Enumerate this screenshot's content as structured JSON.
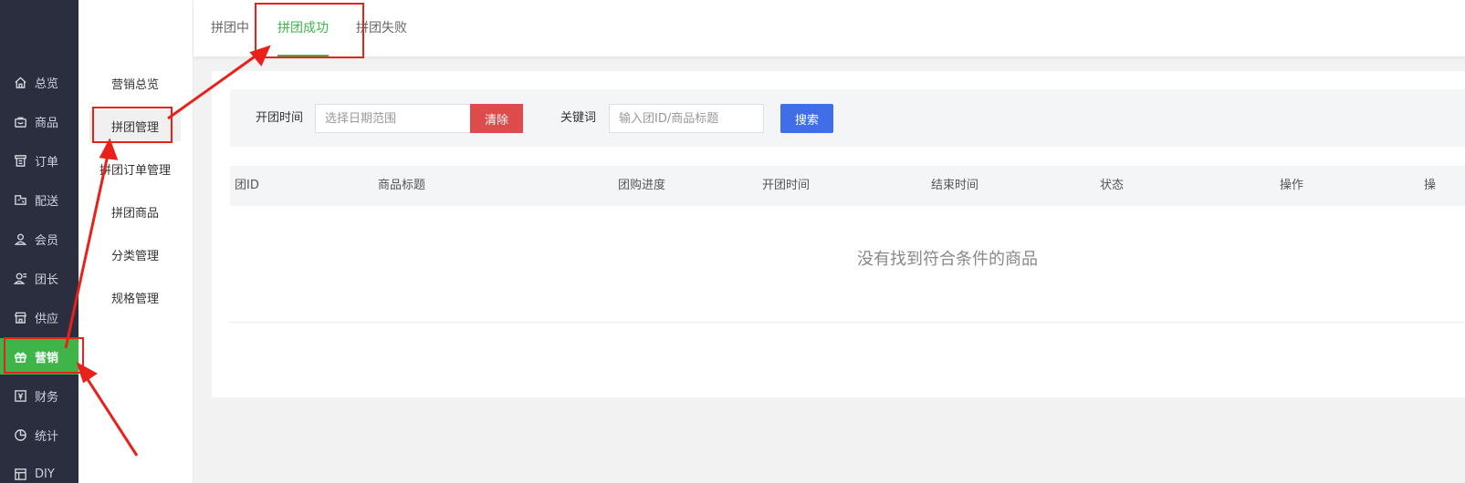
{
  "sidebar": {
    "items": [
      {
        "label": "总览",
        "icon": "home-icon"
      },
      {
        "label": "商品",
        "icon": "bag-icon"
      },
      {
        "label": "订单",
        "icon": "order-icon"
      },
      {
        "label": "配送",
        "icon": "delivery-icon"
      },
      {
        "label": "会员",
        "icon": "user-icon"
      },
      {
        "label": "团长",
        "icon": "leader-icon"
      },
      {
        "label": "供应",
        "icon": "store-icon"
      },
      {
        "label": "营销",
        "icon": "gift-icon",
        "active": true
      },
      {
        "label": "财务",
        "icon": "yen-icon"
      },
      {
        "label": "统计",
        "icon": "pie-chart-icon"
      },
      {
        "label": "DIY",
        "icon": "layout-icon"
      }
    ]
  },
  "subnav": {
    "items": [
      {
        "label": "营销总览"
      },
      {
        "label": "拼团管理",
        "active": true
      },
      {
        "label": "拼团订单管理"
      },
      {
        "label": "拼团商品"
      },
      {
        "label": "分类管理"
      },
      {
        "label": "规格管理"
      }
    ]
  },
  "tabs": [
    {
      "label": "拼团中"
    },
    {
      "label": "拼团成功",
      "active": true
    },
    {
      "label": "拼团失败"
    }
  ],
  "filter": {
    "date_label": "开团时间",
    "date_placeholder": "选择日期范围",
    "clear_label": "清除",
    "keyword_label": "关键词",
    "keyword_placeholder": "输入团ID/商品标题",
    "search_label": "搜索"
  },
  "table": {
    "columns": [
      "团ID",
      "商品标题",
      "团购进度",
      "开团时间",
      "结束时间",
      "状态",
      "操作",
      "操"
    ],
    "empty_text": "没有找到符合条件的商品"
  },
  "colors": {
    "accent": "#3fb549",
    "sidebar_bg": "#2b2e3e",
    "clear_button": "#dd4b4b",
    "search_button": "#3f6ee8",
    "annotation": "#e8221b"
  }
}
